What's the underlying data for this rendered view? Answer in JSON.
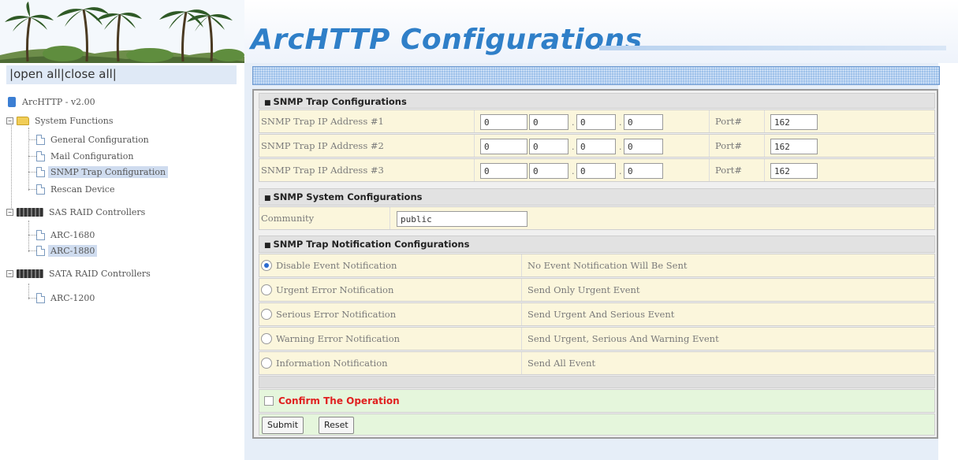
{
  "header": {
    "title": "ArcHTTP Configurations"
  },
  "nav": {
    "open_all": "open all",
    "close_all": "close all",
    "root": "ArcHTTP - v2.00",
    "system_functions": "System Functions",
    "items": [
      {
        "label": "General Configuration"
      },
      {
        "label": "Mail Configuration"
      },
      {
        "label": "SNMP Trap Configuration",
        "selected": true
      },
      {
        "label": "Rescan Device"
      }
    ],
    "sas_group": "SAS RAID Controllers",
    "sas_items": [
      {
        "label": "ARC-1680"
      },
      {
        "label": "ARC-1880",
        "selected": true
      }
    ],
    "sata_group": "SATA RAID Controllers",
    "sata_items": [
      {
        "label": "ARC-1200"
      }
    ]
  },
  "trap": {
    "section_title": "SNMP Trap Configurations",
    "rows": [
      {
        "label": "SNMP Trap IP Address #1",
        "ip": [
          "0",
          "0",
          "0",
          "0"
        ],
        "port_label": "Port#",
        "port": "162"
      },
      {
        "label": "SNMP Trap IP Address #2",
        "ip": [
          "0",
          "0",
          "0",
          "0"
        ],
        "port_label": "Port#",
        "port": "162"
      },
      {
        "label": "SNMP Trap IP Address #3",
        "ip": [
          "0",
          "0",
          "0",
          "0"
        ],
        "port_label": "Port#",
        "port": "162"
      }
    ]
  },
  "system": {
    "section_title": "SNMP System Configurations",
    "community_label": "Community",
    "community_value": "public"
  },
  "notify": {
    "section_title": "SNMP Trap Notification Configurations",
    "options": [
      {
        "label": "Disable Event Notification",
        "desc": "No Event Notification Will Be Sent",
        "checked": true
      },
      {
        "label": "Urgent Error Notification",
        "desc": "Send Only Urgent Event",
        "checked": false
      },
      {
        "label": "Serious Error Notification",
        "desc": "Send Urgent And Serious Event",
        "checked": false
      },
      {
        "label": "Warning Error Notification",
        "desc": "Send Urgent, Serious And Warning Event",
        "checked": false
      },
      {
        "label": "Information Notification",
        "desc": "Send All Event",
        "checked": false
      }
    ]
  },
  "confirm": {
    "label": "Confirm The Operation",
    "checked": false
  },
  "buttons": {
    "submit": "Submit",
    "reset": "Reset"
  },
  "colors": {
    "title": "#2f7fc8",
    "confirm": "#e02020",
    "selected_bg": "#cfdcef"
  }
}
